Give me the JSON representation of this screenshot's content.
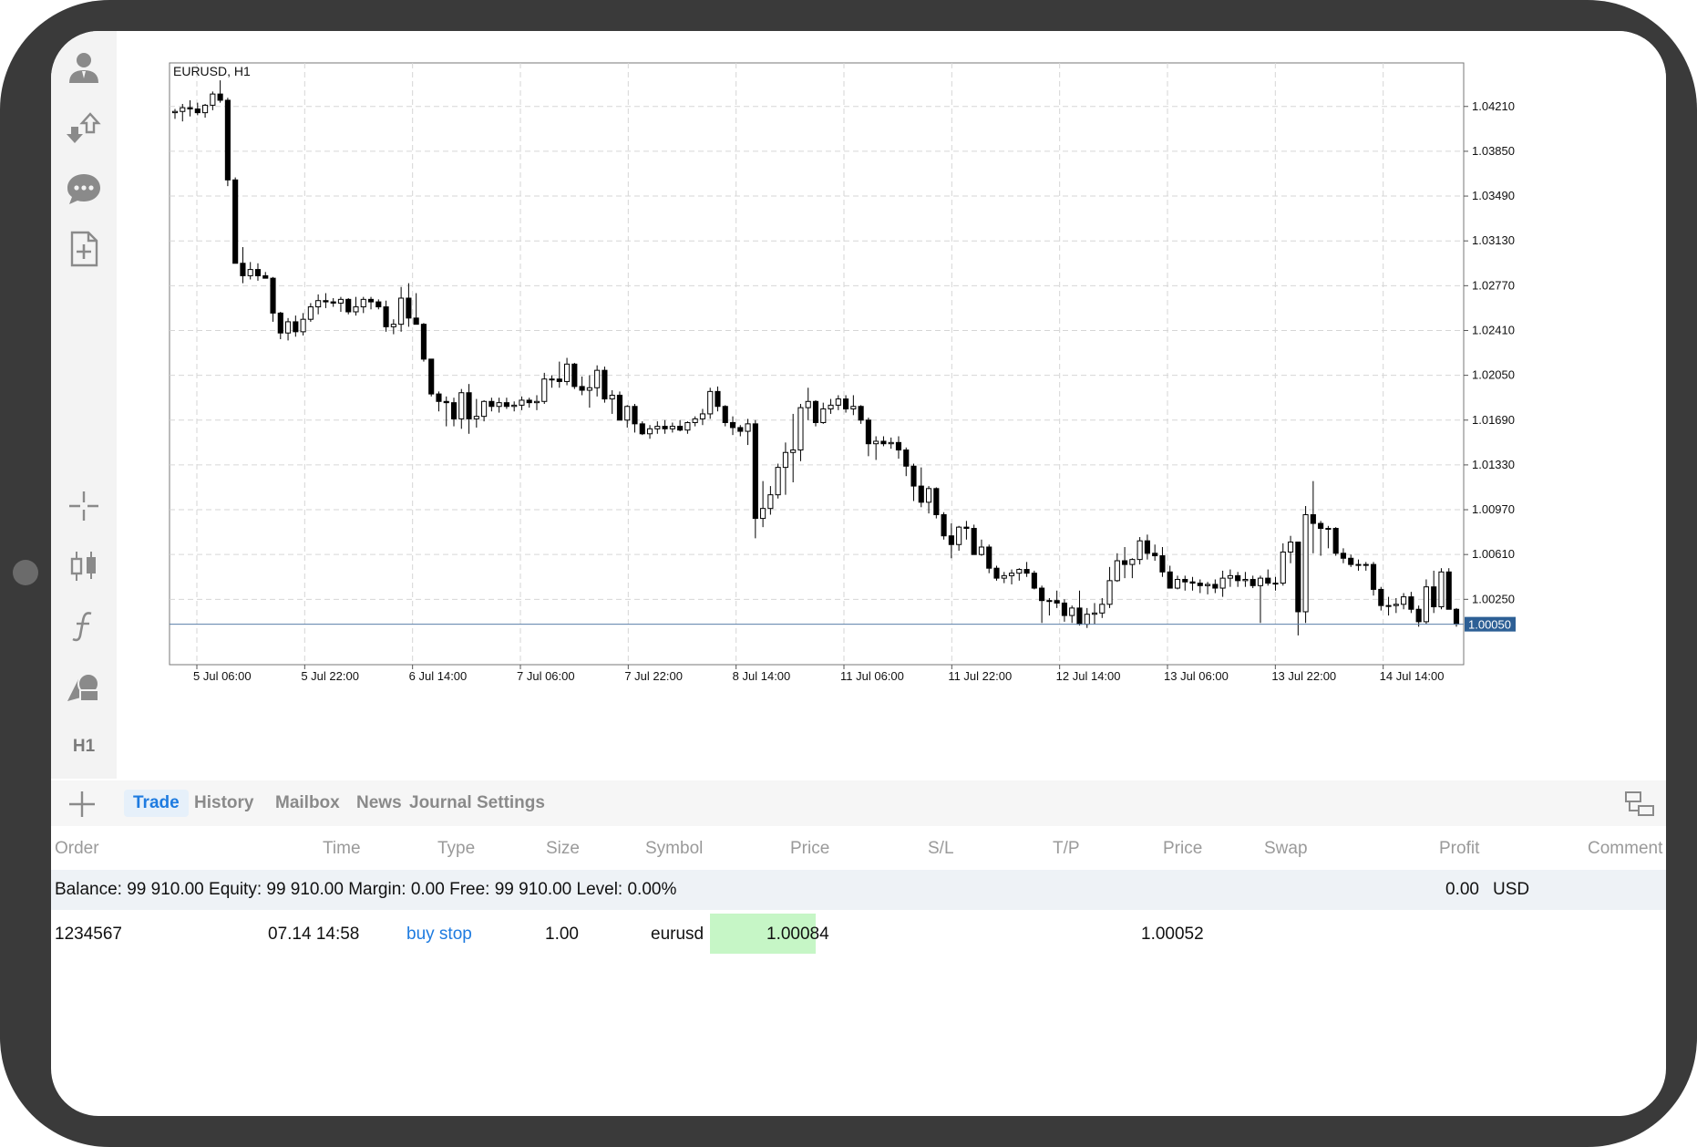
{
  "toolbar": {
    "top_icons": [
      "account-icon",
      "trade-arrows-icon",
      "chat-icon",
      "new-document-icon"
    ],
    "bottom_icons": [
      "crosshair-icon",
      "candles-icon",
      "function-icon",
      "objects-icon"
    ],
    "timeframe": "H1"
  },
  "chart": {
    "title": "EURUSD, H1",
    "current_price": "1.00050",
    "y_labels": [
      "1.04210",
      "1.03850",
      "1.03490",
      "1.03130",
      "1.02770",
      "1.02410",
      "1.02050",
      "1.01690",
      "1.01330",
      "1.00970",
      "1.00610",
      "1.00250"
    ],
    "x_labels": [
      "5 Jul 06:00",
      "5 Jul 22:00",
      "6 Jul 14:00",
      "7 Jul 06:00",
      "7 Jul 22:00",
      "8 Jul 14:00",
      "11 Jul 06:00",
      "11 Jul 22:00",
      "12 Jul 14:00",
      "13 Jul 06:00",
      "13 Jul 22:00",
      "14 Jul 14:00"
    ],
    "colors": {
      "bull_fill": "#ffffff",
      "bear_fill": "#000000",
      "grid": "#d6d6d6",
      "price_line": "#5a7ea8",
      "price_tag": "#2d5f95"
    }
  },
  "chart_data": {
    "type": "candlestick",
    "title": "EURUSD, H1",
    "y_range": [
      0.9993,
      1.0456
    ],
    "series": [
      {
        "ohlc": [
          [
            1.0416,
            1.0419,
            1.0411,
            1.0417
          ],
          [
            1.0417,
            1.0423,
            1.0409,
            1.042
          ],
          [
            1.042,
            1.0426,
            1.0413,
            1.0419
          ],
          [
            1.0419,
            1.0424,
            1.0414,
            1.0416
          ],
          [
            1.0416,
            1.0423,
            1.0412,
            1.0422
          ],
          [
            1.0422,
            1.0433,
            1.0418,
            1.0431
          ],
          [
            1.0431,
            1.0442,
            1.0424,
            1.0426
          ],
          [
            1.0426,
            1.0428,
            1.0357,
            1.0362
          ],
          [
            1.0362,
            1.0364,
            1.0296,
            1.0295
          ],
          [
            1.0295,
            1.0308,
            1.0279,
            1.0285
          ],
          [
            1.0285,
            1.0296,
            1.0282,
            1.029
          ],
          [
            1.029,
            1.0295,
            1.0281,
            1.0285
          ],
          [
            1.0285,
            1.0288,
            1.0283,
            1.0283
          ],
          [
            1.0283,
            1.0284,
            1.0248,
            1.0255
          ],
          [
            1.0255,
            1.0256,
            1.0234,
            1.0239
          ],
          [
            1.0239,
            1.0251,
            1.0233,
            1.0248
          ],
          [
            1.0248,
            1.0253,
            1.0236,
            1.024
          ],
          [
            1.024,
            1.0255,
            1.0237,
            1.025
          ],
          [
            1.025,
            1.0263,
            1.0248,
            1.026
          ],
          [
            1.026,
            1.027,
            1.0254,
            1.0265
          ],
          [
            1.0265,
            1.0271,
            1.0259,
            1.0264
          ],
          [
            1.0264,
            1.0267,
            1.026,
            1.0263
          ],
          [
            1.0263,
            1.0268,
            1.0256,
            1.0266
          ],
          [
            1.0266,
            1.0267,
            1.0254,
            1.0256
          ],
          [
            1.0256,
            1.0268,
            1.0253,
            1.026
          ],
          [
            1.026,
            1.0268,
            1.0255,
            1.0266
          ],
          [
            1.0266,
            1.0268,
            1.0258,
            1.0264
          ],
          [
            1.0264,
            1.0266,
            1.0258,
            1.026
          ],
          [
            1.026,
            1.0265,
            1.024,
            1.0244
          ],
          [
            1.0244,
            1.025,
            1.0238,
            1.0246
          ],
          [
            1.0246,
            1.0276,
            1.024,
            1.0267
          ],
          [
            1.0267,
            1.0279,
            1.0244,
            1.0251
          ],
          [
            1.0251,
            1.0271,
            1.0246,
            1.0246
          ],
          [
            1.0246,
            1.0247,
            1.0216,
            1.0218
          ],
          [
            1.0218,
            1.0218,
            1.0188,
            1.019
          ],
          [
            1.019,
            1.0192,
            1.0176,
            1.0184
          ],
          [
            1.0184,
            1.0188,
            1.0164,
            1.0183
          ],
          [
            1.0183,
            1.0187,
            1.0164,
            1.017
          ],
          [
            1.017,
            1.0194,
            1.0162,
            1.0191
          ],
          [
            1.0191,
            1.0198,
            1.0158,
            1.017
          ],
          [
            1.017,
            1.0186,
            1.0163,
            1.0172
          ],
          [
            1.0172,
            1.0185,
            1.0168,
            1.0184
          ],
          [
            1.0184,
            1.0187,
            1.0176,
            1.018
          ],
          [
            1.018,
            1.0187,
            1.0175,
            1.0183
          ],
          [
            1.0183,
            1.0187,
            1.0178,
            1.018
          ],
          [
            1.018,
            1.0184,
            1.0176,
            1.0181
          ],
          [
            1.0181,
            1.0188,
            1.0177,
            1.0185
          ],
          [
            1.0185,
            1.0187,
            1.0179,
            1.0183
          ],
          [
            1.0183,
            1.0189,
            1.0177,
            1.0184
          ],
          [
            1.0184,
            1.0207,
            1.0182,
            1.0202
          ],
          [
            1.0202,
            1.0205,
            1.0195,
            1.0202
          ],
          [
            1.0202,
            1.0216,
            1.0195,
            1.02
          ],
          [
            1.02,
            1.0219,
            1.0197,
            1.0214
          ],
          [
            1.0214,
            1.0215,
            1.0194,
            1.0196
          ],
          [
            1.0196,
            1.0204,
            1.0189,
            1.0193
          ],
          [
            1.0193,
            1.0205,
            1.0179,
            1.0195
          ],
          [
            1.0195,
            1.0213,
            1.0188,
            1.0209
          ],
          [
            1.0209,
            1.0212,
            1.0183,
            1.0186
          ],
          [
            1.0186,
            1.0193,
            1.0174,
            1.0189
          ],
          [
            1.0189,
            1.0192,
            1.0171,
            1.0169
          ],
          [
            1.0169,
            1.0181,
            1.0163,
            1.018
          ],
          [
            1.018,
            1.0182,
            1.0159,
            1.0166
          ],
          [
            1.0166,
            1.0168,
            1.0157,
            1.0158
          ],
          [
            1.0158,
            1.0165,
            1.0154,
            1.0162
          ],
          [
            1.0162,
            1.0168,
            1.0158,
            1.0164
          ],
          [
            1.0164,
            1.0169,
            1.0158,
            1.0162
          ],
          [
            1.0162,
            1.0167,
            1.0159,
            1.0164
          ],
          [
            1.0164,
            1.0169,
            1.016,
            1.0161
          ],
          [
            1.0161,
            1.0168,
            1.0158,
            1.0167
          ],
          [
            1.0167,
            1.0172,
            1.0164,
            1.017
          ],
          [
            1.017,
            1.0178,
            1.0165,
            1.0174
          ],
          [
            1.0174,
            1.0195,
            1.017,
            1.0192
          ],
          [
            1.0192,
            1.0196,
            1.0176,
            1.018
          ],
          [
            1.018,
            1.0181,
            1.0164,
            1.0167
          ],
          [
            1.0167,
            1.0172,
            1.0157,
            1.0163
          ],
          [
            1.0163,
            1.0165,
            1.0156,
            1.016
          ],
          [
            1.016,
            1.017,
            1.0149,
            1.0166
          ],
          [
            1.0166,
            1.0169,
            1.0074,
            1.009
          ],
          [
            1.009,
            1.012,
            1.0083,
            1.0098
          ],
          [
            1.0098,
            1.0116,
            1.0093,
            1.0109
          ],
          [
            1.0109,
            1.0134,
            1.0106,
            1.0131
          ],
          [
            1.0131,
            1.0151,
            1.0109,
            1.0143
          ],
          [
            1.0143,
            1.0174,
            1.0119,
            1.0145
          ],
          [
            1.0145,
            1.0182,
            1.0136,
            1.0179
          ],
          [
            1.0179,
            1.0195,
            1.0169,
            1.0184
          ],
          [
            1.0184,
            1.0185,
            1.0164,
            1.0167
          ],
          [
            1.0167,
            1.0183,
            1.0166,
            1.0178
          ],
          [
            1.0178,
            1.0186,
            1.0174,
            1.0181
          ],
          [
            1.0181,
            1.0189,
            1.0177,
            1.0186
          ],
          [
            1.0186,
            1.0189,
            1.0175,
            1.0178
          ],
          [
            1.0178,
            1.0189,
            1.0173,
            1.018
          ],
          [
            1.018,
            1.0181,
            1.0166,
            1.0169
          ],
          [
            1.0169,
            1.0171,
            1.014,
            1.015
          ],
          [
            1.015,
            1.0156,
            1.0137,
            1.0152
          ],
          [
            1.0152,
            1.0156,
            1.0148,
            1.015
          ],
          [
            1.015,
            1.0155,
            1.0146,
            1.0151
          ],
          [
            1.0151,
            1.0156,
            1.0138,
            1.0145
          ],
          [
            1.0145,
            1.0147,
            1.0124,
            1.0132
          ],
          [
            1.0132,
            1.0134,
            1.0104,
            1.0116
          ],
          [
            1.0116,
            1.0131,
            1.0099,
            1.0103
          ],
          [
            1.0103,
            1.0116,
            1.0094,
            1.0114
          ],
          [
            1.0114,
            1.0115,
            1.009,
            1.0093
          ],
          [
            1.0093,
            1.0095,
            1.0073,
            1.0076
          ],
          [
            1.0076,
            1.0086,
            1.0058,
            1.0069
          ],
          [
            1.0069,
            1.0084,
            1.0064,
            1.0083
          ],
          [
            1.0083,
            1.0088,
            1.0073,
            1.0082
          ],
          [
            1.0082,
            1.0085,
            1.0061,
            1.0061
          ],
          [
            1.0061,
            1.0073,
            1.006,
            1.0067
          ],
          [
            1.0067,
            1.0069,
            1.0046,
            1.005
          ],
          [
            1.005,
            1.0052,
            1.004,
            1.0042
          ],
          [
            1.0042,
            1.0047,
            1.0038,
            1.0044
          ],
          [
            1.0044,
            1.0049,
            1.0037,
            1.0046
          ],
          [
            1.0046,
            1.005,
            1.004,
            1.0049
          ],
          [
            1.0049,
            1.0055,
            1.0043,
            1.0046
          ],
          [
            1.0046,
            1.0048,
            1.0033,
            1.0034
          ],
          [
            1.0034,
            1.0036,
            1.0006,
            1.0024
          ],
          [
            1.0024,
            1.0026,
            1.0012,
            1.0024
          ],
          [
            1.0024,
            1.0032,
            1.0018,
            1.0022
          ],
          [
            1.0022,
            1.0025,
            1.0007,
            1.0012
          ],
          [
            1.0012,
            1.002,
            1.0006,
            1.0018
          ],
          [
            1.0018,
            1.0032,
            1.0004,
            1.0005
          ],
          [
            1.0005,
            1.0018,
            1.0002,
            1.0013
          ],
          [
            1.0013,
            1.0022,
            1.0005,
            1.0014
          ],
          [
            1.0014,
            1.0026,
            1.001,
            1.0021
          ],
          [
            1.0021,
            1.0051,
            1.0018,
            1.004
          ],
          [
            1.004,
            1.0062,
            1.0039,
            1.0056
          ],
          [
            1.0056,
            1.0067,
            1.0042,
            1.0053
          ],
          [
            1.0053,
            1.0058,
            1.0042,
            1.0057
          ],
          [
            1.0057,
            1.0075,
            1.0053,
            1.0072
          ],
          [
            1.0072,
            1.0077,
            1.0057,
            1.0062
          ],
          [
            1.0062,
            1.0069,
            1.0056,
            1.006
          ],
          [
            1.006,
            1.0067,
            1.0043,
            1.0047
          ],
          [
            1.0047,
            1.0052,
            1.0037,
            1.0034
          ],
          [
            1.0034,
            1.0044,
            1.0033,
            1.0041
          ],
          [
            1.0041,
            1.0044,
            1.0032,
            1.0039
          ],
          [
            1.0039,
            1.0043,
            1.0032,
            1.0038
          ],
          [
            1.0038,
            1.0041,
            1.003,
            1.0036
          ],
          [
            1.0036,
            1.0039,
            1.0029,
            1.0037
          ],
          [
            1.0037,
            1.0041,
            1.003,
            1.0034
          ],
          [
            1.0034,
            1.0048,
            1.0027,
            1.0042
          ],
          [
            1.0042,
            1.0049,
            1.0035,
            1.0044
          ],
          [
            1.0044,
            1.0047,
            1.0035,
            1.004
          ],
          [
            1.004,
            1.0047,
            1.0035,
            1.0041
          ],
          [
            1.0041,
            1.0044,
            1.0034,
            1.0036
          ],
          [
            1.0036,
            1.0044,
            1.0006,
            1.0042
          ],
          [
            1.0042,
            1.0049,
            1.0036,
            1.0038
          ],
          [
            1.0038,
            1.0043,
            1.0032,
            1.0038
          ],
          [
            1.0038,
            1.007,
            1.0036,
            1.0063
          ],
          [
            1.0063,
            1.0076,
            1.0054,
            1.0071
          ],
          [
            1.0071,
            1.007,
            0.9996,
            1.0015
          ],
          [
            1.0015,
            1.01,
            1.0006,
            1.0093
          ],
          [
            1.0093,
            1.012,
            1.0062,
            1.0086
          ],
          [
            1.0086,
            1.0088,
            1.006,
            1.0082
          ],
          [
            1.0082,
            1.0084,
            1.0066,
            1.0082
          ],
          [
            1.0082,
            1.0083,
            1.006,
            1.0062
          ],
          [
            1.0062,
            1.0066,
            1.0054,
            1.0058
          ],
          [
            1.0058,
            1.0061,
            1.0051,
            1.0053
          ],
          [
            1.0053,
            1.0057,
            1.0048,
            1.0053
          ],
          [
            1.0053,
            1.0055,
            1.0048,
            1.0053
          ],
          [
            1.0053,
            1.0055,
            1.0028,
            1.0033
          ],
          [
            1.0033,
            1.0035,
            1.0016,
            1.002
          ],
          [
            1.002,
            1.0027,
            1.0012,
            1.002
          ],
          [
            1.002,
            1.0026,
            1.0014,
            1.0021
          ],
          [
            1.0021,
            1.003,
            1.0017,
            1.0027
          ],
          [
            1.0027,
            1.0031,
            1.0014,
            1.0017
          ],
          [
            1.0017,
            1.002,
            1.0003,
            1.0007
          ],
          [
            1.0007,
            1.0041,
            1.0005,
            1.0035
          ],
          [
            1.0035,
            1.0048,
            1.0014,
            1.0019
          ],
          [
            1.0019,
            1.005,
            1.0017,
            1.0047
          ],
          [
            1.0047,
            1.005,
            1.002,
            1.0017
          ],
          [
            1.0017,
            1.0018,
            1.0003,
            1.0005
          ]
        ]
      }
    ]
  },
  "tabs": [
    {
      "label": "Trade",
      "active": true
    },
    {
      "label": "History",
      "active": false
    },
    {
      "label": "Mailbox",
      "active": false
    },
    {
      "label": "News",
      "active": false
    },
    {
      "label": "Journal",
      "active": false
    },
    {
      "label": "Settings",
      "active": false
    }
  ],
  "table": {
    "headers": {
      "order": "Order",
      "time": "Time",
      "type": "Type",
      "size": "Size",
      "symbol": "Symbol",
      "price": "Price",
      "sl": "S/L",
      "tp": "T/P",
      "price2": "Price",
      "swap": "Swap",
      "profit": "Profit",
      "comment": "Comment"
    },
    "balance_text": "Balance: 99 910.00 Equity: 99 910.00 Margin: 0.00 Free: 99 910.00 Level: 0.00%",
    "total_profit": "0.00",
    "currency": "USD",
    "order": {
      "id": "1234567",
      "time": "07.14 14:58",
      "type": "buy stop",
      "size": "1.00",
      "symbol": "eurusd",
      "price": "1.00084",
      "current_price": "1.00052"
    }
  }
}
